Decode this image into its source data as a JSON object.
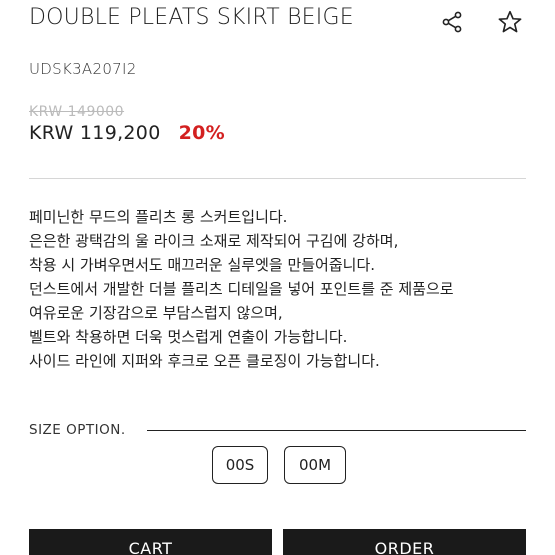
{
  "product": {
    "title": "DOUBLE PLEATS SKIRT BEIGE",
    "sku": "UDSK3A207I2",
    "original_price": "KRW 149000",
    "price": "KRW 119,200",
    "discount": "20%"
  },
  "icons": {
    "share": "share-icon",
    "favorite": "star-icon"
  },
  "description": [
    "페미닌한 무드의 플리츠 롱 스커트입니다.",
    "은은한 광택감의 울 라이크 소재로 제작되어 구김에 강하며,",
    "착용 시 가벼우면서도 매끄러운 실루엣을 만들어줍니다.",
    "던스트에서 개발한 더블 플리츠 디테일을 넣어 포인트를 준 제품으로",
    "여유로운 기장감으로 부담스럽지 않으며,",
    "벨트와 착용하면 더욱 멋스럽게 연출이 가능합니다.",
    "사이드 라인에 지퍼와 후크로 오픈 클로징이 가능합니다."
  ],
  "size_option": {
    "label": "SIZE OPTION.",
    "options": [
      "00S",
      "00M"
    ]
  },
  "actions": {
    "cart": "CART",
    "order": "ORDER"
  },
  "colors": {
    "discount": "#d32020",
    "button_bg": "#1a1a1a",
    "strike_price": "#bbbbbb"
  }
}
